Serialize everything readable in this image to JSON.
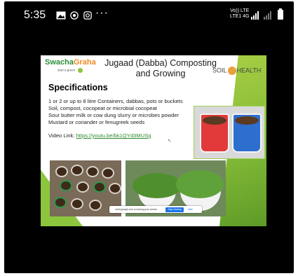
{
  "status_bar": {
    "time": "5:35",
    "icons": [
      "gallery-icon",
      "whatsapp-icon",
      "instagram-icon"
    ],
    "more": "···",
    "network_line1": "Vo)) LTE",
    "network_line2": "LTE1 4G"
  },
  "slide": {
    "brand": {
      "part1": "Swacha",
      "part2": "Graha",
      "tagline": "start a green",
      "tagline_badge": "home"
    },
    "title": "Jugaad (Dabba) Composting and Growing",
    "partner_logo": {
      "left": "SOIL",
      "right": "HEALTH"
    },
    "specifications_heading": "Specifications",
    "bullets": [
      "1 or 2 or up to 8 litre Containers, dabbas, pots or buckets",
      "Soil, compost, cocopeat or microbial  cocopeat",
      "Sour butter milk or cow dung slurry or microbes powder",
      "Mustard or coriander or fenugreek seeds"
    ],
    "video_label": "Video Link:",
    "video_url": "https://youtu.be/bk1QYd3MUSg"
  },
  "share_bar": {
    "message": "meet.google.com is sharing your screen",
    "stop_label": "Stop sharing",
    "hide_label": "Hide"
  },
  "colors": {
    "brand_green": "#2a8f3a",
    "accent_green": "#8cc63f",
    "link_green": "#2f8a2f",
    "share_blue": "#1a73e8"
  }
}
